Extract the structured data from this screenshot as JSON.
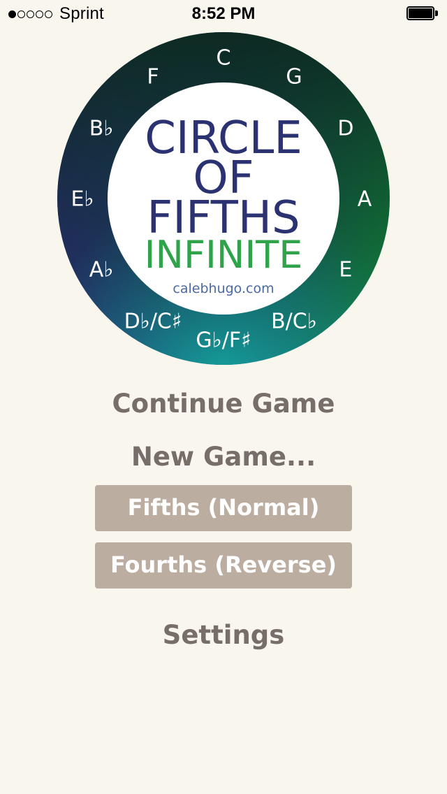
{
  "status_bar": {
    "signal_dots_filled": 1,
    "signal_dots_total": 5,
    "carrier": "Sprint",
    "time": "8:52 PM",
    "battery_icon": "battery-full-icon"
  },
  "logo": {
    "notes": [
      "C",
      "G",
      "D",
      "A",
      "E",
      "B/C♭",
      "G♭/F♯",
      "D♭/C♯",
      "A♭",
      "E♭",
      "B♭",
      "F"
    ],
    "title_line1": "CIRCLE",
    "title_line2": "OF",
    "title_line3": "FIFTHS",
    "subtitle": "INFINITE",
    "website": "calebhugo.com",
    "colors": {
      "ring_top": "#0d2a22",
      "ring_left": "#2a2f7a",
      "ring_right": "#129140",
      "ring_bottom": "#127e86",
      "title": "#2b3272",
      "subtitle": "#2ea34a"
    }
  },
  "menu": {
    "continue_label": "Continue Game",
    "new_game_label": "New Game...",
    "fifths_label": "Fifths (Normal)",
    "fourths_label": "Fourths (Reverse)",
    "settings_label": "Settings"
  },
  "colors": {
    "background": "#f9f6ee",
    "menu_text": "#776e67",
    "button_bg": "#bbada0",
    "button_text": "#ffffff"
  }
}
